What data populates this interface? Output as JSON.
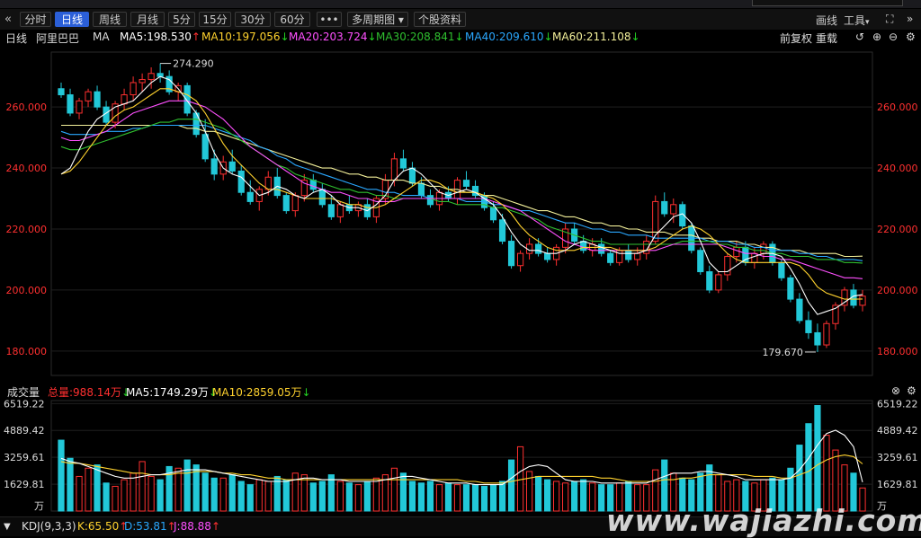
{
  "toolbar": {
    "back_icon": "«",
    "periods": [
      "分时",
      "日线",
      "周线",
      "月线",
      "5分",
      "15分",
      "30分",
      "60分"
    ],
    "active_period": "日线",
    "more_label": "•••",
    "multi_period": "多周期图",
    "stock_info": "个股资料",
    "draw": "画线",
    "tools": "工具",
    "forward_icon": "»"
  },
  "legend": {
    "period": "日线",
    "stock": "阿里巴巴",
    "ma": "MA",
    "ma5": "MA5:198.530",
    "ma10": "MA10:197.056",
    "ma20": "MA20:203.724",
    "ma30": "MA30:208.841",
    "ma40": "MA40:209.610",
    "ma60": "MA60:211.108",
    "adjust": "前复权",
    "reload": "重载"
  },
  "colors": {
    "ma5": "#ffffff",
    "ma10": "#ffd22e",
    "ma20": "#ff50ff",
    "ma30": "#2fbf2f",
    "ma40": "#2aa8ff",
    "ma60": "#f3f09a",
    "up": "#ff3030",
    "down": "#22c8d8",
    "axis": "#ff3030",
    "grid": "#1f1f1f"
  },
  "volume_legend": {
    "title": "成交量",
    "total": "总量:988.14万",
    "ma5": "MA5:1749.29万",
    "ma10": "MA10:2859.05万"
  },
  "kdj": {
    "name": "KDJ(9,3,3)",
    "k": "K:65.50",
    "d": "D:53.81",
    "j": "J:88.88"
  },
  "watermark": "www.wajiazhi.com",
  "chart_data": {
    "type": "candlestick",
    "price_ticks": [
      "260.000",
      "240.000",
      "220.000",
      "200.000",
      "180.000"
    ],
    "price_tick_values": [
      260,
      240,
      220,
      200,
      180
    ],
    "ylim": [
      172,
      278
    ],
    "high_label": "274.290",
    "low_label": "179.670",
    "volume_ticks": [
      "6519.22",
      "4889.42",
      "3259.61",
      "1629.81"
    ],
    "volume_tick_values": [
      6519.22,
      4889.42,
      3259.61,
      1629.81
    ],
    "volume_unit": "万",
    "volume_ylim": [
      0,
      6700
    ],
    "candles": [
      [
        266,
        268,
        263,
        264
      ],
      [
        264,
        266,
        257,
        258
      ],
      [
        258,
        263,
        256,
        262
      ],
      [
        262,
        266,
        260,
        265
      ],
      [
        265,
        267,
        259,
        260
      ],
      [
        260,
        262,
        254,
        255
      ],
      [
        255,
        262,
        253,
        261
      ],
      [
        261,
        266,
        259,
        264
      ],
      [
        264,
        270,
        262,
        268
      ],
      [
        268,
        271,
        265,
        269
      ],
      [
        269,
        273,
        266,
        271
      ],
      [
        271,
        274.29,
        268,
        270
      ],
      [
        270,
        272,
        264,
        265
      ],
      [
        265,
        268,
        262,
        267
      ],
      [
        267,
        268,
        257,
        258
      ],
      [
        258,
        259,
        250,
        251
      ],
      [
        251,
        256,
        242,
        243
      ],
      [
        243,
        246,
        236,
        238
      ],
      [
        238,
        244,
        236,
        242
      ],
      [
        242,
        246,
        238,
        239
      ],
      [
        239,
        241,
        231,
        232
      ],
      [
        232,
        236,
        228,
        229
      ],
      [
        229,
        234,
        226,
        233
      ],
      [
        233,
        239,
        231,
        237
      ],
      [
        237,
        240,
        230,
        231
      ],
      [
        231,
        232,
        225,
        226
      ],
      [
        226,
        232,
        224,
        231
      ],
      [
        231,
        238,
        229,
        236
      ],
      [
        236,
        238,
        232,
        233
      ],
      [
        233,
        235,
        227,
        228
      ],
      [
        228,
        231,
        223,
        224
      ],
      [
        224,
        229,
        222,
        228
      ],
      [
        228,
        231,
        225,
        226
      ],
      [
        226,
        229,
        224,
        228
      ],
      [
        228,
        230,
        223,
        224
      ],
      [
        224,
        231,
        222,
        230
      ],
      [
        230,
        238,
        228,
        236
      ],
      [
        236,
        245,
        234,
        243
      ],
      [
        243,
        246,
        239,
        240
      ],
      [
        240,
        242,
        234,
        235
      ],
      [
        235,
        237,
        230,
        231
      ],
      [
        231,
        233,
        227,
        228
      ],
      [
        228,
        233,
        226,
        232
      ],
      [
        232,
        234,
        229,
        230
      ],
      [
        230,
        237,
        228,
        236
      ],
      [
        236,
        239,
        233,
        234
      ],
      [
        234,
        236,
        230,
        231
      ],
      [
        231,
        232,
        226,
        227
      ],
      [
        227,
        229,
        222,
        223
      ],
      [
        223,
        225,
        215,
        216
      ],
      [
        216,
        218,
        207,
        208
      ],
      [
        208,
        213,
        206,
        212
      ],
      [
        212,
        217,
        210,
        215
      ],
      [
        215,
        217,
        211,
        212
      ],
      [
        212,
        214,
        209,
        210
      ],
      [
        210,
        215,
        208,
        214
      ],
      [
        214,
        222,
        212,
        220
      ],
      [
        220,
        222,
        215,
        216
      ],
      [
        216,
        218,
        212,
        213
      ],
      [
        213,
        217,
        211,
        215
      ],
      [
        215,
        217,
        211,
        212
      ],
      [
        212,
        213,
        208,
        209
      ],
      [
        209,
        214,
        208,
        213
      ],
      [
        213,
        215,
        209,
        210
      ],
      [
        210,
        214,
        208,
        212
      ],
      [
        212,
        218,
        210,
        216
      ],
      [
        216,
        231,
        215,
        229
      ],
      [
        229,
        232,
        224,
        225
      ],
      [
        225,
        230,
        222,
        228
      ],
      [
        228,
        229,
        220,
        221
      ],
      [
        221,
        222,
        212,
        213
      ],
      [
        213,
        214,
        205,
        206
      ],
      [
        206,
        208,
        199,
        200
      ],
      [
        200,
        206,
        199,
        205
      ],
      [
        205,
        212,
        203,
        211
      ],
      [
        211,
        216,
        209,
        214
      ],
      [
        214,
        216,
        208,
        209
      ],
      [
        209,
        214,
        207,
        212
      ],
      [
        212,
        216,
        210,
        215
      ],
      [
        215,
        216,
        208,
        209
      ],
      [
        209,
        210,
        203,
        204
      ],
      [
        204,
        205,
        196,
        197
      ],
      [
        197,
        199,
        189,
        190
      ],
      [
        190,
        193,
        184,
        186
      ],
      [
        186,
        189,
        179.67,
        182
      ],
      [
        182,
        190,
        181,
        189
      ],
      [
        189,
        196,
        187,
        195
      ],
      [
        195,
        201,
        193,
        200
      ],
      [
        200,
        202,
        194,
        195
      ],
      [
        195,
        200,
        193,
        198
      ]
    ],
    "ma5": [
      238,
      240,
      246,
      252,
      256,
      258,
      260,
      261,
      262,
      265,
      268,
      270,
      269,
      266,
      262,
      258,
      252,
      245,
      240,
      238,
      237,
      234,
      231,
      232,
      234,
      233,
      231,
      230,
      232,
      233,
      231,
      228,
      227,
      227,
      226,
      228,
      231,
      236,
      239,
      240,
      238,
      235,
      232,
      231,
      232,
      233,
      232,
      230,
      228,
      224,
      219,
      215,
      213,
      213,
      212,
      212,
      213,
      215,
      216,
      215,
      214,
      213,
      212,
      212,
      212,
      213,
      218,
      221,
      224,
      225,
      222,
      216,
      209,
      206,
      206,
      208,
      210,
      211,
      212,
      212,
      211,
      207,
      202,
      196,
      192,
      193,
      194,
      196,
      198,
      198.53
    ],
    "ma10": [
      238,
      239,
      242,
      246,
      250,
      254,
      257,
      259,
      260,
      262,
      264,
      266,
      266,
      265,
      264,
      262,
      258,
      253,
      248,
      244,
      241,
      238,
      235,
      233,
      233,
      232,
      231,
      230,
      230,
      230,
      230,
      229,
      228,
      228,
      227,
      227,
      228,
      230,
      232,
      234,
      236,
      236,
      235,
      233,
      232,
      232,
      232,
      231,
      230,
      228,
      225,
      221,
      218,
      216,
      214,
      213,
      213,
      213,
      214,
      214,
      214,
      214,
      213,
      213,
      213,
      213,
      214,
      216,
      218,
      220,
      221,
      220,
      218,
      215,
      212,
      210,
      209,
      209,
      209,
      209,
      209,
      209,
      208,
      205,
      201,
      199,
      198,
      197,
      197,
      197.06
    ],
    "ma20": [
      250,
      249,
      249,
      250,
      251,
      252,
      254,
      256,
      258,
      259,
      260,
      261,
      262,
      262,
      262,
      261,
      260,
      258,
      256,
      253,
      250,
      247,
      245,
      243,
      241,
      239,
      237,
      235,
      234,
      233,
      232,
      232,
      231,
      230,
      230,
      229,
      229,
      229,
      230,
      230,
      230,
      230,
      230,
      230,
      230,
      230,
      230,
      230,
      229,
      228,
      227,
      226,
      224,
      222,
      220,
      218,
      216,
      215,
      214,
      213,
      213,
      213,
      213,
      213,
      213,
      213,
      213,
      214,
      215,
      215,
      215,
      215,
      215,
      215,
      214,
      213,
      212,
      212,
      211,
      211,
      210,
      210,
      209,
      208,
      207,
      206,
      205,
      204,
      204,
      203.72
    ],
    "ma30": [
      247,
      246,
      246,
      247,
      248,
      249,
      250,
      251,
      252,
      253,
      254,
      255,
      255,
      256,
      256,
      256,
      255,
      254,
      253,
      251,
      249,
      247,
      245,
      243,
      241,
      240,
      238,
      237,
      236,
      235,
      234,
      233,
      233,
      232,
      232,
      231,
      231,
      230,
      230,
      230,
      230,
      230,
      229,
      229,
      228,
      228,
      228,
      228,
      227,
      227,
      226,
      225,
      224,
      223,
      221,
      220,
      219,
      218,
      217,
      216,
      216,
      215,
      215,
      215,
      215,
      215,
      215,
      215,
      215,
      216,
      216,
      216,
      216,
      215,
      215,
      214,
      214,
      213,
      213,
      212,
      212,
      211,
      211,
      211,
      210,
      210,
      210,
      209,
      209,
      208.84
    ],
    "ma40": [
      252,
      251,
      251,
      251,
      251,
      252,
      252,
      252,
      253,
      253,
      254,
      254,
      254,
      254,
      254,
      254,
      254,
      253,
      252,
      251,
      250,
      249,
      247,
      246,
      244,
      243,
      241,
      240,
      239,
      238,
      237,
      236,
      235,
      234,
      233,
      233,
      232,
      232,
      231,
      231,
      231,
      230,
      230,
      230,
      230,
      229,
      229,
      229,
      228,
      228,
      227,
      226,
      226,
      225,
      224,
      223,
      222,
      222,
      221,
      220,
      220,
      219,
      219,
      218,
      218,
      218,
      217,
      217,
      217,
      217,
      217,
      217,
      216,
      216,
      216,
      215,
      215,
      214,
      214,
      213,
      213,
      213,
      212,
      212,
      211,
      211,
      210,
      210,
      210,
      209.61
    ],
    "ma60": [
      254,
      254,
      254,
      254,
      254,
      254,
      254,
      254,
      254,
      254,
      254,
      254,
      254,
      254,
      253,
      253,
      252,
      252,
      251,
      250,
      249,
      248,
      247,
      246,
      245,
      244,
      243,
      242,
      241,
      240,
      240,
      239,
      238,
      238,
      237,
      237,
      236,
      236,
      236,
      235,
      235,
      234,
      234,
      233,
      233,
      232,
      232,
      231,
      231,
      230,
      229,
      228,
      227,
      226,
      226,
      225,
      224,
      224,
      223,
      222,
      222,
      221,
      221,
      220,
      220,
      219,
      219,
      219,
      218,
      218,
      218,
      217,
      217,
      216,
      216,
      216,
      215,
      215,
      214,
      214,
      213,
      213,
      213,
      212,
      212,
      212,
      212,
      211,
      211,
      211.11
    ],
    "volume": [
      4300,
      3200,
      2100,
      2600,
      2800,
      1700,
      1500,
      1900,
      2300,
      3000,
      2100,
      1900,
      2700,
      2600,
      3100,
      2800,
      2300,
      2000,
      2000,
      2200,
      1800,
      1600,
      1900,
      1800,
      2100,
      1900,
      2300,
      2200,
      1700,
      1800,
      2200,
      1800,
      1700,
      1600,
      1800,
      2000,
      2200,
      2600,
      2300,
      1800,
      1700,
      1800,
      1600,
      1700,
      1600,
      1600,
      1600,
      1500,
      1600,
      1800,
      3100,
      3900,
      2400,
      2100,
      1900,
      1800,
      1700,
      1800,
      1900,
      1700,
      1600,
      1600,
      1700,
      1800,
      1600,
      1600,
      2500,
      3100,
      2300,
      2000,
      1900,
      2300,
      2800,
      2200,
      1800,
      1900,
      1800,
      1700,
      1900,
      2000,
      1900,
      2600,
      4000,
      5300,
      6400,
      4600,
      3700,
      2800,
      2300,
      1400
    ],
    "volume_ma5": [
      3200,
      3000,
      2900,
      2700,
      2500,
      2300,
      2100,
      2000,
      2000,
      2100,
      2200,
      2200,
      2300,
      2400,
      2500,
      2500,
      2500,
      2400,
      2300,
      2200,
      2100,
      2000,
      1900,
      1800,
      1800,
      1800,
      1900,
      2000,
      2000,
      1900,
      1900,
      1900,
      1800,
      1800,
      1800,
      1800,
      1900,
      2000,
      2100,
      2100,
      2000,
      1900,
      1800,
      1700,
      1700,
      1700,
      1600,
      1600,
      1600,
      1600,
      2000,
      2400,
      2700,
      2800,
      2700,
      2300,
      1900,
      1800,
      1800,
      1800,
      1700,
      1700,
      1700,
      1700,
      1700,
      1700,
      1900,
      2100,
      2300,
      2300,
      2300,
      2400,
      2400,
      2300,
      2200,
      2100,
      1900,
      1900,
      1900,
      1900,
      1900,
      2000,
      2500,
      3200,
      4000,
      4700,
      4900,
      4600,
      3900,
      1749
    ],
    "volume_ma10": [
      3000,
      2900,
      2900,
      2800,
      2700,
      2600,
      2500,
      2400,
      2300,
      2300,
      2200,
      2200,
      2200,
      2300,
      2300,
      2400,
      2400,
      2400,
      2300,
      2300,
      2200,
      2200,
      2100,
      2000,
      2000,
      1900,
      1900,
      1900,
      1900,
      1900,
      1900,
      1900,
      1900,
      1900,
      1900,
      1900,
      1900,
      1900,
      1900,
      1900,
      1900,
      1900,
      1900,
      1900,
      1900,
      1800,
      1800,
      1700,
      1700,
      1700,
      1800,
      1900,
      2000,
      2100,
      2100,
      2100,
      2100,
      2100,
      2100,
      2100,
      2000,
      2000,
      1900,
      1800,
      1800,
      1800,
      1800,
      1900,
      1900,
      2000,
      2000,
      2100,
      2200,
      2200,
      2200,
      2200,
      2200,
      2100,
      2100,
      2100,
      2000,
      2000,
      2200,
      2400,
      2800,
      3100,
      3300,
      3400,
      3300,
      2859
    ]
  }
}
